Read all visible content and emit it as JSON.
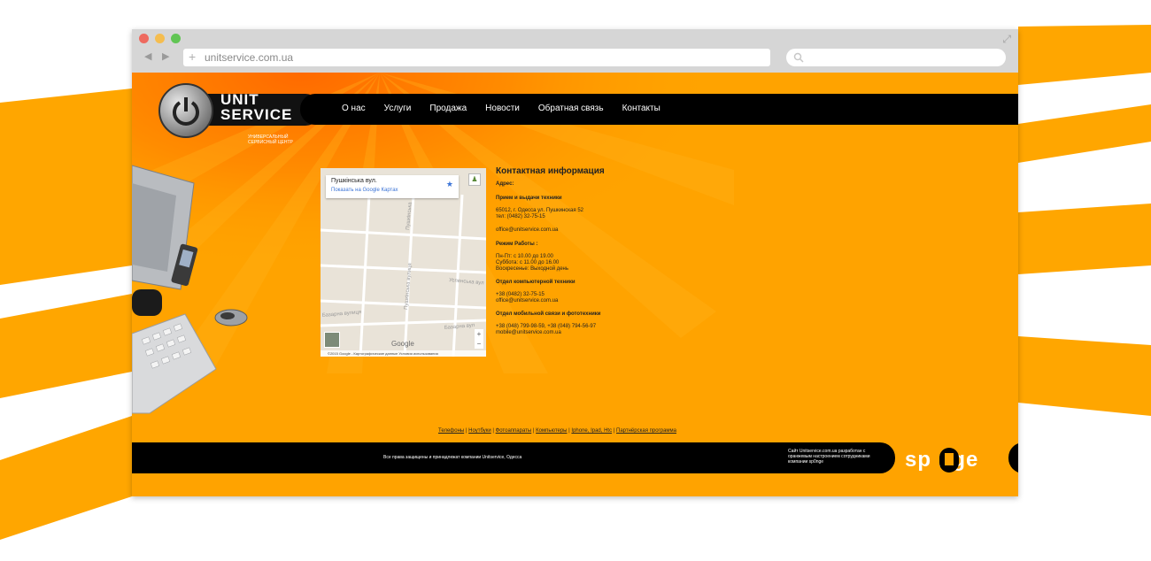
{
  "browser": {
    "url": "unitservice.com.ua",
    "traffic_colors": [
      "#ee6a5f",
      "#f5bd4f",
      "#61c554"
    ]
  },
  "logo": {
    "line1": "UNIT",
    "line2": "SERVICE",
    "tagline": "УНИВЕРСАЛЬНЫЙ СЕРВИСНЫЙ ЦЕНТР"
  },
  "nav": {
    "items": [
      "О нас",
      "Услуги",
      "Продажа",
      "Новости",
      "Обратная связь",
      "Контакты"
    ]
  },
  "map": {
    "place_title": "Пушкінська вул.",
    "show_link": "Показать на Google Картах",
    "logo": "Google",
    "footer": "©2015 Google - Картографические данные    Условия использования",
    "zoom_in": "+",
    "zoom_out": "−"
  },
  "contact": {
    "title": "Контактная информация",
    "address_label": "Адрес:",
    "reception_label": "Прием и выдачи техники",
    "reception_text": "65012, г. Одесса ул. Пушкинская 52\nтел: (0482) 32-75-15",
    "reception_email": "office@unitservice.com.ua",
    "hours_label": "Режим Работы :",
    "hours_text": "Пн-Пт: с 10.00 до 19.00\nСуббота: с 11.00 до 16.00\nВоскресенье: Выходной день",
    "computer_label": "Отдел компьютерной техники",
    "computer_text": "+38 (0482) 32-75-15\noffice@unitservice.com.ua",
    "mobile_label": "Отдел мобильной связи и фототехники",
    "mobile_text": "+38 (048) 799-98-59, +38 (048) 794-56-97\nmobile@unitservice.com.ua"
  },
  "footer_links": [
    "Телефоны",
    "Ноутбуки",
    "Фотоаппараты",
    "Компьютеры",
    "Iphone, Ipad, Htc",
    "Партнёрская программа"
  ],
  "footer": {
    "copyright": "Все права защищены и принадлежат компании Unitservice, Одесса",
    "developer": "Сайт Unitservice.com.ua разработан с оранжевым настроением сотрудниками компании sp0nge",
    "sponge": "sp   nge"
  },
  "colors": {
    "page_orange": "#ffa300",
    "bar_black": "#000000",
    "link_blue": "#3a73d6"
  }
}
